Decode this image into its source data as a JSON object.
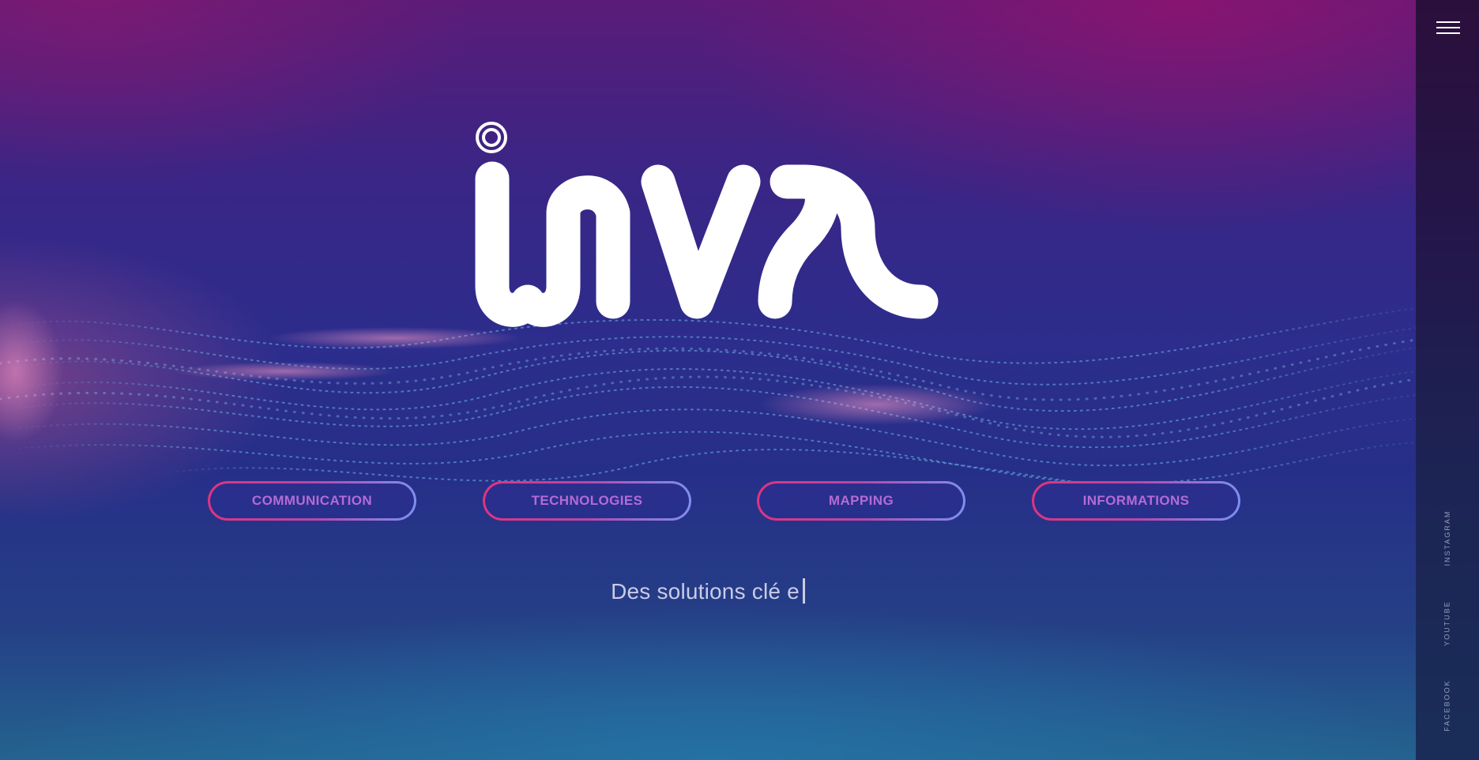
{
  "brand": {
    "logo_text": "inva",
    "accent_gradient": [
      "#e0347f",
      "#b946a8",
      "#7e8ff0"
    ],
    "button_text_color": "#b46bd6"
  },
  "sidebar": {
    "menu_icon": "hamburger-menu-icon",
    "social_links": [
      {
        "label": "INSTAGRAM"
      },
      {
        "label": "YOUTUBE"
      },
      {
        "label": "FACEBOOK"
      }
    ]
  },
  "main": {
    "nav_buttons": [
      {
        "label": "COMMUNICATION"
      },
      {
        "label": "TECHNOLOGIES"
      },
      {
        "label": "MAPPING"
      },
      {
        "label": "INFORMATIONS"
      }
    ],
    "tagline": "Des solutions clé e"
  }
}
